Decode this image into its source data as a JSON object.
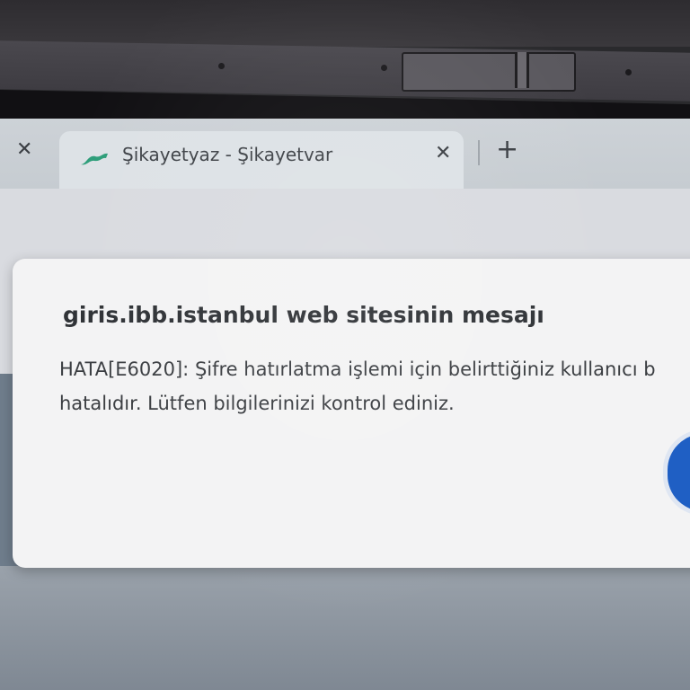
{
  "browser": {
    "prev_tab_close_icon": "close-icon",
    "active_tab": {
      "favicon": "sikayetvar-logo-icon",
      "title": "Şikayetyaz - Şikayetvar",
      "close_icon": "close-icon"
    },
    "new_tab_icon": "plus-icon"
  },
  "dialog": {
    "title": "giris.ibb.istanbul web sitesinin mesajı",
    "message_lines": [
      "HATA[E6020]: Şifre hatırlatma işlemi için belirttiğiniz kullanıcı b",
      "hatalıdır. Lütfen bilgilerinizi kontrol ediniz."
    ]
  },
  "colors": {
    "favicon_green": "#2e9e7a",
    "dialog_button_blue": "#1f5fc4"
  }
}
